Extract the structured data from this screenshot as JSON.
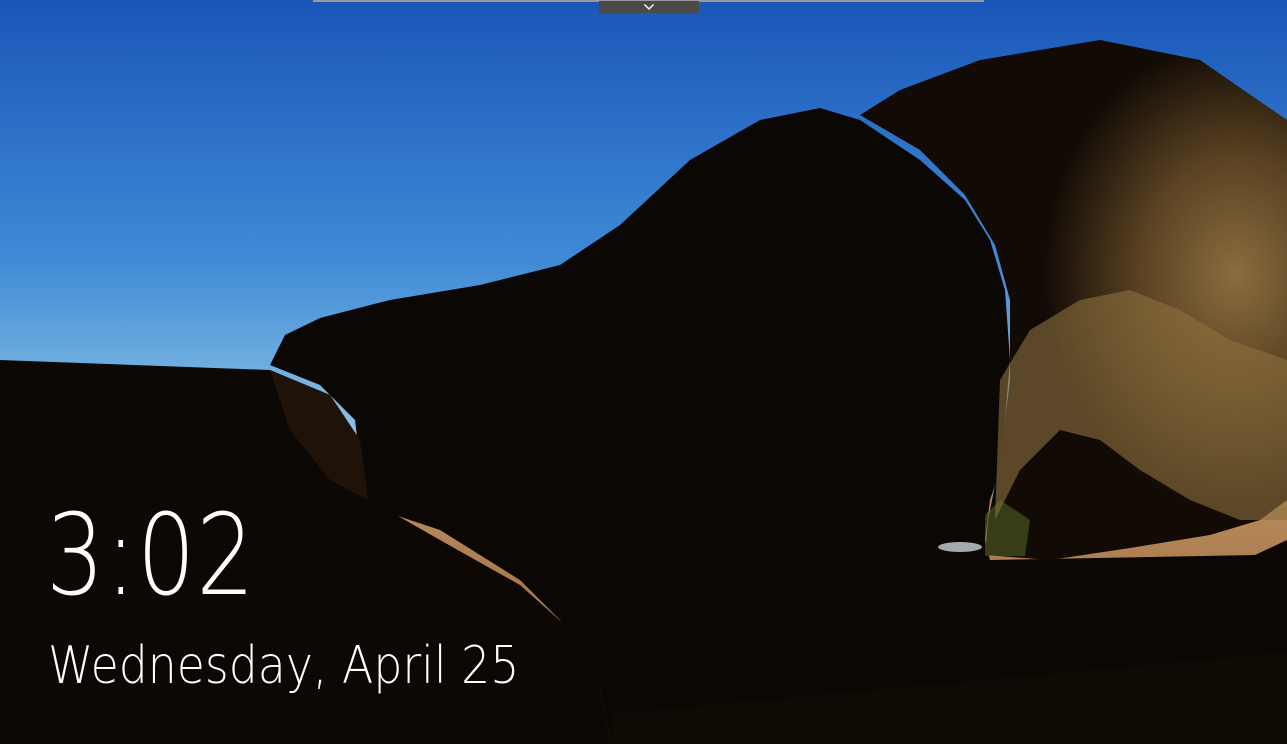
{
  "lockscreen": {
    "time": "3:02",
    "date": "Wednesday, April 25",
    "wallpaper_icon": "cave-beach-landscape",
    "pull_down_icon": "chevron-down-icon"
  },
  "colors": {
    "sky_top": "#1f63c4",
    "sky_bottom": "#7fbfe6",
    "sand": "#a97a4d",
    "cave": "#0b0704",
    "rock": "#7a6131",
    "text": "#ffffff"
  }
}
